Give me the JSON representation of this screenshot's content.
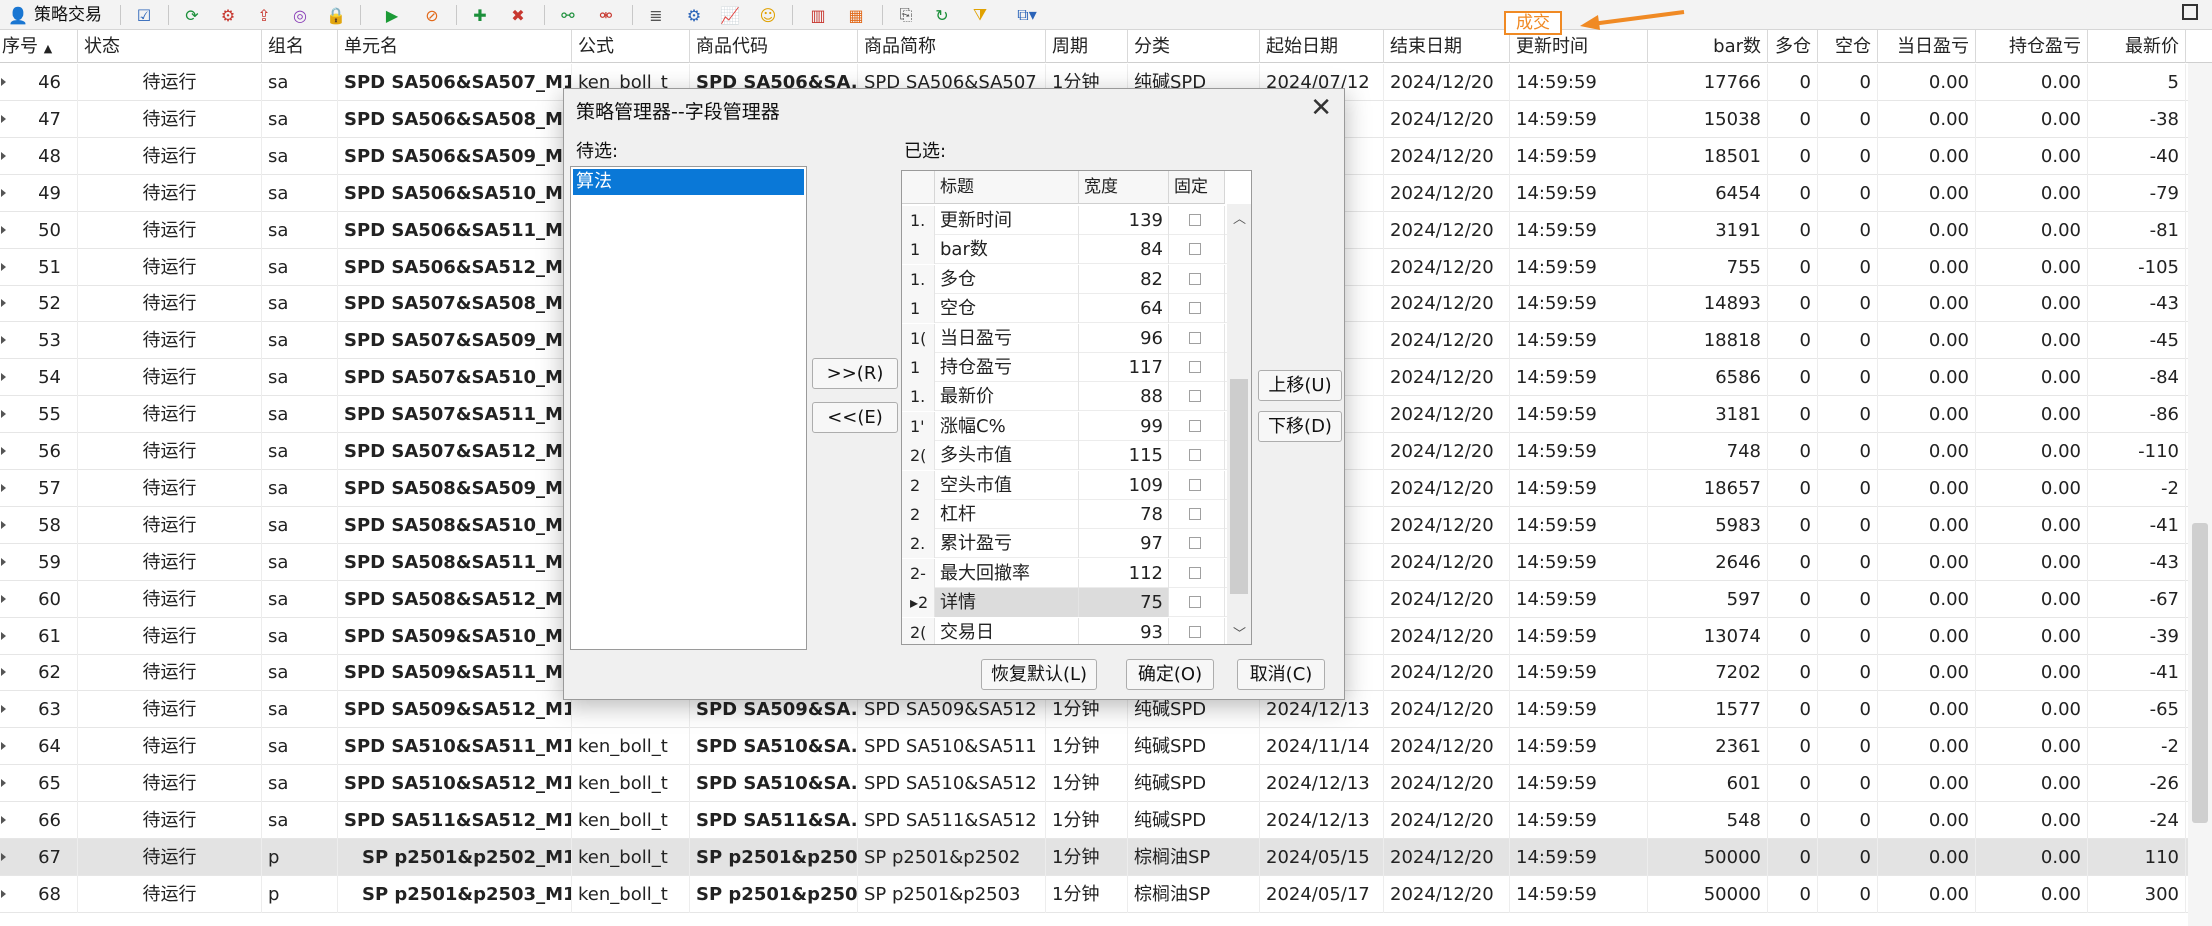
{
  "toolbar": {
    "app_label": "策略交易",
    "badge": "成交"
  },
  "table": {
    "columns": [
      "序号",
      "状态",
      "组名",
      "单元名",
      "公式",
      "商品代码",
      "商品简称",
      "周期",
      "分类",
      "起始日期",
      "结束日期",
      "更新时间",
      "bar数",
      "多仓",
      "空仓",
      "当日盈亏",
      "持仓盈亏",
      "最新价"
    ],
    "sort_arrow": "▲",
    "rows": [
      [
        "46",
        "待运行",
        "sa",
        "SPD SA506&SA507_M1",
        "ken_boll_t",
        "SPD SA506&SA...",
        "SPD SA506&SA507",
        "1分钟",
        "纯碱SPD",
        "2024/07/12",
        "2024/12/20",
        "14:59:59",
        "17766",
        "0",
        "0",
        "0.00",
        "0.00",
        "5"
      ],
      [
        "47",
        "待运行",
        "sa",
        "SPD SA506&SA508_M1",
        "",
        "",
        "",
        "",
        "",
        "14",
        "2024/12/20",
        "14:59:59",
        "15038",
        "0",
        "0",
        "0.00",
        "0.00",
        "-38"
      ],
      [
        "48",
        "待运行",
        "sa",
        "SPD SA506&SA509_M1",
        "",
        "",
        "",
        "",
        "",
        "19",
        "2024/12/20",
        "14:59:59",
        "18501",
        "0",
        "0",
        "0.00",
        "0.00",
        "-40"
      ],
      [
        "49",
        "待运行",
        "sa",
        "SPD SA506&SA510_M1",
        "",
        "",
        "",
        "",
        "",
        "22",
        "2024/12/20",
        "14:59:59",
        "6454",
        "0",
        "0",
        "0.00",
        "0.00",
        "-79"
      ],
      [
        "50",
        "待运行",
        "sa",
        "SPD SA506&SA511_M1",
        "",
        "",
        "",
        "",
        "",
        "14",
        "2024/12/20",
        "14:59:59",
        "3191",
        "0",
        "0",
        "0.00",
        "0.00",
        "-81"
      ],
      [
        "51",
        "待运行",
        "sa",
        "SPD SA506&SA512_M1",
        "",
        "",
        "",
        "",
        "",
        "13",
        "2024/12/20",
        "14:59:59",
        "755",
        "0",
        "0",
        "0.00",
        "0.00",
        "-105"
      ],
      [
        "52",
        "待运行",
        "sa",
        "SPD SA507&SA508_M1",
        "",
        "",
        "",
        "",
        "",
        "14",
        "2024/12/20",
        "14:59:59",
        "14893",
        "0",
        "0",
        "0.00",
        "0.00",
        "-43"
      ],
      [
        "53",
        "待运行",
        "sa",
        "SPD SA507&SA509_M1",
        "",
        "",
        "",
        "",
        "",
        "18",
        "2024/12/20",
        "14:59:59",
        "18818",
        "0",
        "0",
        "0.00",
        "0.00",
        "-45"
      ],
      [
        "54",
        "待运行",
        "sa",
        "SPD SA507&SA510_M1",
        "",
        "",
        "",
        "",
        "",
        "22",
        "2024/12/20",
        "14:59:59",
        "6586",
        "0",
        "0",
        "0.00",
        "0.00",
        "-84"
      ],
      [
        "55",
        "待运行",
        "sa",
        "SPD SA507&SA511_M1",
        "",
        "",
        "",
        "",
        "",
        "14",
        "2024/12/20",
        "14:59:59",
        "3181",
        "0",
        "0",
        "0.00",
        "0.00",
        "-86"
      ],
      [
        "56",
        "待运行",
        "sa",
        "SPD SA507&SA512_M1",
        "",
        "",
        "",
        "",
        "",
        "13",
        "2024/12/20",
        "14:59:59",
        "748",
        "0",
        "0",
        "0.00",
        "0.00",
        "-110"
      ],
      [
        "57",
        "待运行",
        "sa",
        "SPD SA508&SA509_M1",
        "",
        "",
        "",
        "",
        "",
        "18",
        "2024/12/20",
        "14:59:59",
        "18657",
        "0",
        "0",
        "0.00",
        "0.00",
        "-2"
      ],
      [
        "58",
        "待运行",
        "sa",
        "SPD SA508&SA510_M1",
        "",
        "",
        "",
        "",
        "",
        "21",
        "2024/12/20",
        "14:59:59",
        "5983",
        "0",
        "0",
        "0.00",
        "0.00",
        "-41"
      ],
      [
        "59",
        "待运行",
        "sa",
        "SPD SA508&SA511_M1",
        "",
        "",
        "",
        "",
        "",
        "14",
        "2024/12/20",
        "14:59:59",
        "2646",
        "0",
        "0",
        "0.00",
        "0.00",
        "-43"
      ],
      [
        "60",
        "待运行",
        "sa",
        "SPD SA508&SA512_M1",
        "",
        "",
        "",
        "",
        "",
        "13",
        "2024/12/20",
        "14:59:59",
        "597",
        "0",
        "0",
        "0.00",
        "0.00",
        "-67"
      ],
      [
        "61",
        "待运行",
        "sa",
        "SPD SA509&SA510_M1",
        "",
        "",
        "",
        "",
        "",
        "21",
        "2024/12/20",
        "14:59:59",
        "13074",
        "0",
        "0",
        "0.00",
        "0.00",
        "-39"
      ],
      [
        "62",
        "待运行",
        "sa",
        "SPD SA509&SA511_M1",
        "",
        "",
        "",
        "",
        "",
        "14",
        "2024/12/20",
        "14:59:59",
        "7202",
        "0",
        "0",
        "0.00",
        "0.00",
        "-41"
      ],
      [
        "63",
        "待运行",
        "sa",
        "SPD SA509&SA512_M1",
        "",
        "SPD SA509&SA...",
        "SPD SA509&SA512",
        "1分钟",
        "纯碱SPD",
        "2024/12/13",
        "2024/12/20",
        "14:59:59",
        "1577",
        "0",
        "0",
        "0.00",
        "0.00",
        "-65"
      ],
      [
        "64",
        "待运行",
        "sa",
        "SPD SA510&SA511_M1",
        "ken_boll_t",
        "SPD SA510&SA...",
        "SPD SA510&SA511",
        "1分钟",
        "纯碱SPD",
        "2024/11/14",
        "2024/12/20",
        "14:59:59",
        "2361",
        "0",
        "0",
        "0.00",
        "0.00",
        "-2"
      ],
      [
        "65",
        "待运行",
        "sa",
        "SPD SA510&SA512_M1",
        "ken_boll_t",
        "SPD SA510&SA...",
        "SPD SA510&SA512",
        "1分钟",
        "纯碱SPD",
        "2024/12/13",
        "2024/12/20",
        "14:59:59",
        "601",
        "0",
        "0",
        "0.00",
        "0.00",
        "-26"
      ],
      [
        "66",
        "待运行",
        "sa",
        "SPD SA511&SA512_M1",
        "ken_boll_t",
        "SPD SA511&SA...",
        "SPD SA511&SA512",
        "1分钟",
        "纯碱SPD",
        "2024/12/13",
        "2024/12/20",
        "14:59:59",
        "548",
        "0",
        "0",
        "0.00",
        "0.00",
        "-24"
      ],
      [
        "67",
        "待运行",
        "p",
        "SP p2501&p2502_M1",
        "ken_boll_t",
        "SP p2501&p2502",
        "SP p2501&p2502",
        "1分钟",
        "棕榈油SP",
        "2024/05/15",
        "2024/12/20",
        "14:59:59",
        "50000",
        "0",
        "0",
        "0.00",
        "0.00",
        "110"
      ],
      [
        "68",
        "待运行",
        "p",
        "SP p2501&p2503_M1",
        "ken_boll_t",
        "SP p2501&p2503",
        "SP p2501&p2503",
        "1分钟",
        "棕榈油SP",
        "2024/05/17",
        "2024/12/20",
        "14:59:59",
        "50000",
        "0",
        "0",
        "0.00",
        "0.00",
        "300"
      ]
    ]
  },
  "dialog": {
    "title": "策略管理器--字段管理器",
    "close": "✕",
    "available_label": "待选:",
    "available_items": [
      "算法"
    ],
    "selected_label": "已选:",
    "grid_headers": [
      "标题",
      "宽度",
      "固定"
    ],
    "grid_rows": [
      {
        "idx": "1.",
        "title": "更新时间",
        "width": "139"
      },
      {
        "idx": "1",
        "title": "bar数",
        "width": "84"
      },
      {
        "idx": "1.",
        "title": "多仓",
        "width": "82"
      },
      {
        "idx": "1",
        "title": "空仓",
        "width": "64"
      },
      {
        "idx": "1(",
        "title": "当日盈亏",
        "width": "96"
      },
      {
        "idx": "1",
        "title": "持仓盈亏",
        "width": "117"
      },
      {
        "idx": "1.",
        "title": "最新价",
        "width": "88"
      },
      {
        "idx": "1'",
        "title": "涨幅C%",
        "width": "99"
      },
      {
        "idx": "2(",
        "title": "多头市值",
        "width": "115"
      },
      {
        "idx": "2",
        "title": "空头市值",
        "width": "109"
      },
      {
        "idx": "2",
        "title": "杠杆",
        "width": "78"
      },
      {
        "idx": "2.",
        "title": "累计盈亏",
        "width": "97"
      },
      {
        "idx": "2-",
        "title": "最大回撤率",
        "width": "112"
      },
      {
        "idx": "▸2",
        "title": "详情",
        "width": "75"
      },
      {
        "idx": "2(",
        "title": "交易日",
        "width": "93"
      }
    ],
    "btn_add": ">>(R)",
    "btn_remove": "<<(E)",
    "btn_up": "上移(U)",
    "btn_down": "下移(D)",
    "btn_restore": "恢复默认(L)",
    "btn_ok": "确定(O)",
    "btn_cancel": "取消(C)"
  }
}
